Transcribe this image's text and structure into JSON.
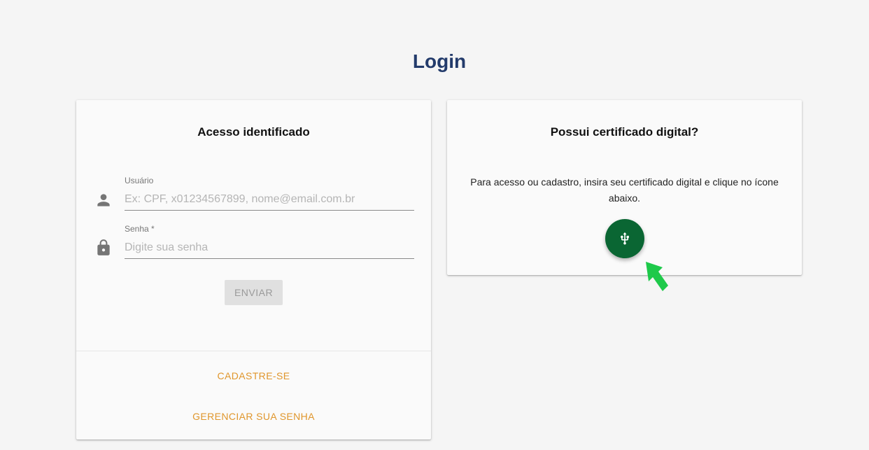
{
  "page": {
    "title": "Login"
  },
  "identified_access": {
    "title": "Acesso identificado",
    "username": {
      "label": "Usuário",
      "value": "",
      "placeholder": "Ex: CPF, x01234567899, nome@email.com.br",
      "icon": "person-icon"
    },
    "password": {
      "label": "Senha *",
      "value": "",
      "placeholder": "Digite sua senha",
      "icon": "lock-icon"
    },
    "submit_label": "ENVIAR",
    "register_link": "CADASTRE-SE",
    "manage_password_link": "GERENCIAR SUA SENHA"
  },
  "digital_certificate": {
    "title": "Possui certificado digital?",
    "description": "Para acesso ou cadastro, insira seu certificado digital e clique no ícone abaixo.",
    "button_icon": "usb-icon"
  },
  "colors": {
    "title": "#233b6b",
    "link": "#e0962c",
    "usb_button": "#0a6633",
    "pointer_arrow": "#1ec94a"
  }
}
